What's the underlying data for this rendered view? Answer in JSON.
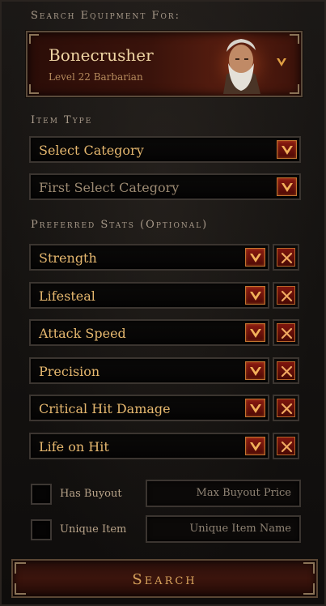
{
  "header": {
    "search_for_label": "Search Equipment For:"
  },
  "character": {
    "name": "Bonecrusher",
    "subtitle": "Level 22 Barbarian"
  },
  "item_type": {
    "label": "Item Type",
    "category": "Select Category",
    "subcategory": "First Select Category"
  },
  "preferred_stats": {
    "label": "Preferred Stats (Optional)",
    "items": [
      {
        "label": "Strength"
      },
      {
        "label": "Lifesteal"
      },
      {
        "label": "Attack Speed"
      },
      {
        "label": "Precision"
      },
      {
        "label": "Critical Hit Damage"
      },
      {
        "label": "Life on Hit"
      }
    ]
  },
  "filters": {
    "has_buyout_label": "Has Buyout",
    "max_buyout_placeholder": "Max Buyout Price",
    "unique_item_label": "Unique Item",
    "unique_item_placeholder": "Unique Item Name"
  },
  "search_button": {
    "label": "Search"
  },
  "colors": {
    "accent": "#e6b86f",
    "button_red": "#8a1a10",
    "border": "#3b3530"
  },
  "icons": {
    "dropdown": "chevron-down-icon",
    "remove": "close-icon"
  }
}
